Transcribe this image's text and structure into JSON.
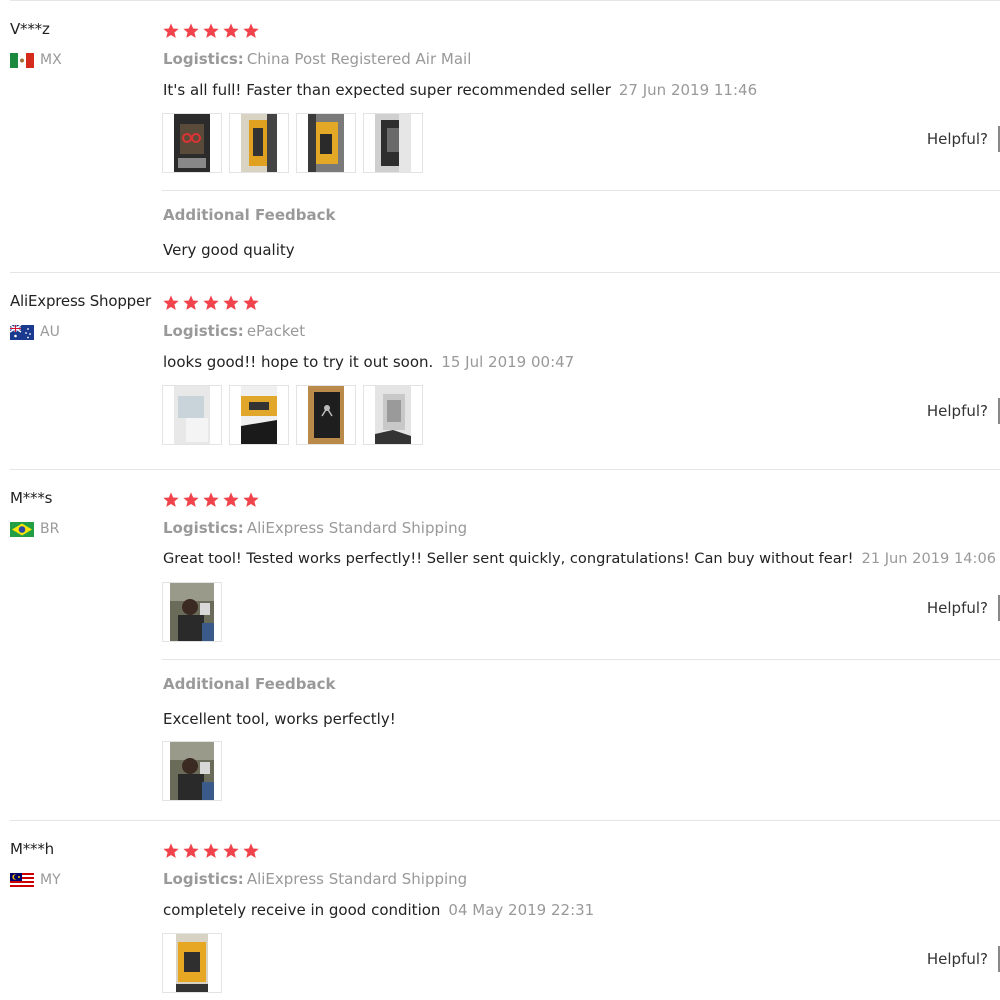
{
  "reviews": [
    {
      "name": "V***z",
      "country": "MX",
      "flag": "mx",
      "rating": 5,
      "logistics_label": "Logistics:",
      "logistics": "China Post Registered Air Mail",
      "comment": "It's all full! Faster than expected super recommended seller",
      "date": "27 Jun 2019 11:46",
      "photo_count": 4,
      "helpful_label": "Helpful?",
      "additional_title": "Additional Feedback",
      "additional_text": "Very good quality"
    },
    {
      "name": "AliExpress Shopper",
      "country": "AU",
      "flag": "au",
      "rating": 5,
      "logistics_label": "Logistics:",
      "logistics": "ePacket",
      "comment": "looks good!! hope to try it out soon.",
      "date": "15 Jul 2019 00:47",
      "photo_count": 4,
      "helpful_label": "Helpful?"
    },
    {
      "name": "M***s",
      "country": "BR",
      "flag": "br",
      "rating": 5,
      "logistics_label": "Logistics:",
      "logistics": "AliExpress Standard Shipping",
      "comment": "Great tool! Tested works perfectly!! Seller sent quickly, congratulations! Can buy without fear!",
      "date": "21 Jun 2019 14:06",
      "photo_count": 1,
      "helpful_label": "Helpful?",
      "additional_title": "Additional Feedback",
      "additional_text": "Excellent tool, works perfectly!",
      "additional_photo_count": 1
    },
    {
      "name": "M***h",
      "country": "MY",
      "flag": "my",
      "rating": 5,
      "logistics_label": "Logistics:",
      "logistics": "AliExpress Standard Shipping",
      "comment": "completely receive in good condition",
      "date": "04 May 2019 22:31",
      "photo_count": 1,
      "helpful_label": "Helpful?"
    }
  ],
  "colors": {
    "star": "#f0434b",
    "muted_text": "#999999",
    "body_text": "#222222",
    "separator": "#e5e5e5"
  },
  "icons": {
    "star": "star-icon",
    "flag": "country-flag-icon"
  }
}
